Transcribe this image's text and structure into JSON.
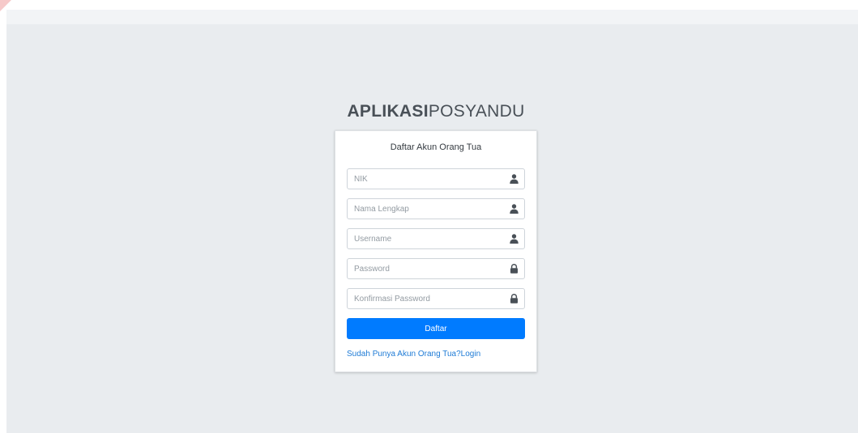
{
  "logo": {
    "bold": "APLIKASI",
    "light": "POSYANDU"
  },
  "card": {
    "message": "Daftar Akun Orang Tua"
  },
  "form": {
    "fields": [
      {
        "placeholder": "NIK",
        "icon": "user-icon"
      },
      {
        "placeholder": "Nama Lengkap",
        "icon": "user-icon"
      },
      {
        "placeholder": "Username",
        "icon": "user-icon"
      },
      {
        "placeholder": "Password",
        "icon": "lock-icon"
      },
      {
        "placeholder": "Konfirmasi Password",
        "icon": "lock-icon"
      }
    ],
    "submit_label": "Daftar"
  },
  "links": {
    "login": "Sudah Punya Akun Orang Tua?Login"
  },
  "colors": {
    "background": "#e9ecef",
    "primary": "#007bff",
    "link": "#1e7bd6",
    "icon": "#495057"
  }
}
